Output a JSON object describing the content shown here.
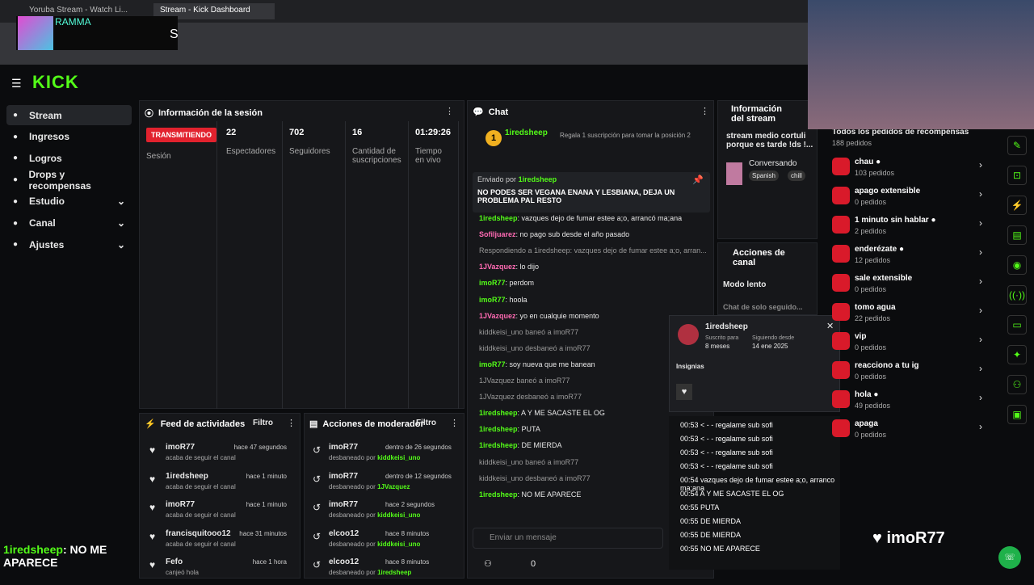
{
  "browser": {
    "tabs": [
      "Yoruba Stream - Watch Li...",
      "Stream - Kick Dashboard"
    ]
  },
  "stream_overlay": {
    "streamer_name": "RAMMA",
    "letter": "S"
  },
  "logo": "KICK",
  "sidebar": [
    {
      "label": "Stream",
      "active": true
    },
    {
      "label": "Ingresos"
    },
    {
      "label": "Logros"
    },
    {
      "label": "Drops y recompensas"
    },
    {
      "label": "Estudio",
      "chev": true
    },
    {
      "label": "Canal",
      "chev": true
    },
    {
      "label": "Ajustes",
      "chev": true
    }
  ],
  "session": {
    "title": "Información de la sesión",
    "live": "TRANSMITIENDO",
    "live_sub": "Sesión",
    "stats": [
      {
        "val": "22",
        "lbl": "Espectadores"
      },
      {
        "val": "702",
        "lbl": "Seguidores"
      },
      {
        "val": "16",
        "lbl": "Cantidad de suscripciones"
      },
      {
        "val": "01:29:26",
        "lbl": "Tiempo en vivo"
      }
    ]
  },
  "feed": {
    "title": "Feed de actividades",
    "filter": "Filtro",
    "rows": [
      {
        "user": "imoR77",
        "time": "hace 47 segundos",
        "sub": "acaba de seguir el canal"
      },
      {
        "user": "1iredsheep",
        "time": "hace 1 minuto",
        "sub": "acaba de seguir el canal"
      },
      {
        "user": "imoR77",
        "time": "hace 1 minuto",
        "sub": "acaba de seguir el canal"
      },
      {
        "user": "francisquitooo12",
        "time": "hace 31 minutos",
        "sub": "acaba de seguir el canal"
      },
      {
        "user": "Fefo",
        "time": "hace 1 hora",
        "sub": "canjeó hola"
      }
    ]
  },
  "mod": {
    "title": "Acciones de moderador",
    "filter": "Filtro",
    "rows": [
      {
        "user": "imoR77",
        "time": "dentro de 26 segundos",
        "sub": "desbaneado por",
        "by": "kiddkeisi_uno"
      },
      {
        "user": "imoR77",
        "time": "dentro de 12 segundos",
        "sub": "desbaneado por",
        "by": "1JVazquez"
      },
      {
        "user": "imoR77",
        "time": "hace 2 segundos",
        "sub": "desbaneado por",
        "by": "kiddkeisi_uno"
      },
      {
        "user": "elcoo12",
        "time": "hace 8 minutos",
        "sub": "desbaneado por",
        "by": "kiddkeisi_uno"
      },
      {
        "user": "elcoo12",
        "time": "hace 8 minutos",
        "sub": "desbaneado por",
        "by": "1iredsheep"
      }
    ]
  },
  "chat": {
    "title": "Chat",
    "top_user": "1iredsheep",
    "top_count": "1",
    "gift_text": "Regala 1 suscripción para tomar la posición 2",
    "pinned_by": "Enviado por",
    "pinned_user": "1iredsheep",
    "pinned_msg": "NO PODES SER VEGANA ENANA Y LESBIANA, DEJA UN PROBLEMA PAL RESTO",
    "lines": [
      {
        "user": "1iredsheep",
        "msg": "vazques dejo de fumar estee a;o, arrancó ma;ana",
        "cls": "g"
      },
      {
        "user": "Sofiljuarez",
        "msg": "no pago sub desde el año pasado",
        "cls": "pink"
      },
      {
        "user": "",
        "msg": "Respondiendo a 1iredsheep: vazques dejo de fumar estee a;o, arran...",
        "cls": "grey"
      },
      {
        "user": "1JVazquez",
        "msg": "lo dijo",
        "cls": "pink"
      },
      {
        "user": "imoR77",
        "msg": "perdom",
        "cls": "g"
      },
      {
        "user": "imoR77",
        "msg": "hoola",
        "cls": "g"
      },
      {
        "user": "1JVazquez",
        "msg": "yo en cualquie momento",
        "cls": "pink"
      },
      {
        "user": "kiddkeisi_uno",
        "msg": "baneó a imoR77",
        "cls": "grey"
      },
      {
        "user": "kiddkeisi_uno",
        "msg": "desbaneó a imoR77",
        "cls": "grey"
      },
      {
        "user": "imoR77",
        "msg": "soy nueva que me banean",
        "cls": "g"
      },
      {
        "user": "1JVazquez",
        "msg": "baneó a imoR77",
        "cls": "grey"
      },
      {
        "user": "1JVazquez",
        "msg": "desbaneó a imoR77",
        "cls": "grey"
      },
      {
        "user": "1iredsheep",
        "msg": "A Y ME SACASTE EL OG",
        "cls": "g"
      },
      {
        "user": "1iredsheep",
        "msg": "PUTA",
        "cls": "g"
      },
      {
        "user": "1iredsheep",
        "msg": "DE MIERDA",
        "cls": "g"
      },
      {
        "user": "kiddkeisi_uno",
        "msg": "baneó a imoR77",
        "cls": "grey"
      },
      {
        "user": "kiddkeisi_uno",
        "msg": "desbaneó a imoR77",
        "cls": "grey"
      },
      {
        "user": "1iredsheep",
        "msg": "NO ME APARECE",
        "cls": "g"
      }
    ],
    "input_placeholder": "Enviar un mensaje",
    "count": "0"
  },
  "stream_info": {
    "title": "Información del stream",
    "text": "stream medio cortuli porque es tarde !ds !...",
    "category": "Conversando",
    "tags": [
      "Spanish",
      "chill"
    ]
  },
  "channel_actions": {
    "title": "Acciones de canal",
    "slow": "Modo lento",
    "chat_follow": "Chat de solo seguido..."
  },
  "user_popup": {
    "user": "1iredsheep",
    "sub_lbl": "Suscrito para",
    "sub_val": "8 meses",
    "follow_lbl": "Siguiendo desde",
    "follow_val": "14 ene 2025",
    "badges_lbl": "Insignias"
  },
  "user_log": [
    "00:53 < - - regalame sub sofi",
    "00:53 < - - regalame sub sofi",
    "00:53 < - - regalame sub sofi",
    "00:53 < - - regalame sub sofi",
    "00:54 vazques dejo de fumar estee a;o, arranco ma;ana",
    "00:54 A Y ME SACASTE EL OG",
    "00:55 PUTA",
    "00:55 DE MIERDA",
    "00:55 DE MIERDA",
    "00:55 NO ME APARECE"
  ],
  "rewards": {
    "header": "Todos los pedidos de recompensas",
    "header_sub": "188 pedidos",
    "items": [
      {
        "title": "chau",
        "sub": "103 pedidos",
        "dot": true
      },
      {
        "title": "apago extensible",
        "sub": "0 pedidos"
      },
      {
        "title": "1 minuto sin hablar",
        "sub": "2 pedidos",
        "dot": true
      },
      {
        "title": "enderézate",
        "sub": "12 pedidos",
        "dot": true
      },
      {
        "title": "sale extensible",
        "sub": "0 pedidos"
      },
      {
        "title": "tomo agua",
        "sub": "22 pedidos"
      },
      {
        "title": "vip",
        "sub": "0 pedidos"
      },
      {
        "title": "reacciono a tu ig",
        "sub": "0 pedidos"
      },
      {
        "title": "hola",
        "sub": "49 pedidos",
        "dot": true
      },
      {
        "title": "apaga",
        "sub": "0 pedidos"
      }
    ]
  },
  "overlay": {
    "follower": "imoR77",
    "chat_user": "1iredsheep",
    "chat_msg": ": NO ME",
    "chat_msg2": "APARECE"
  },
  "colors": {
    "accent": "#53fc18",
    "live": "#e2222e",
    "bg": "#0b0c0e",
    "panel": "#16171a"
  }
}
